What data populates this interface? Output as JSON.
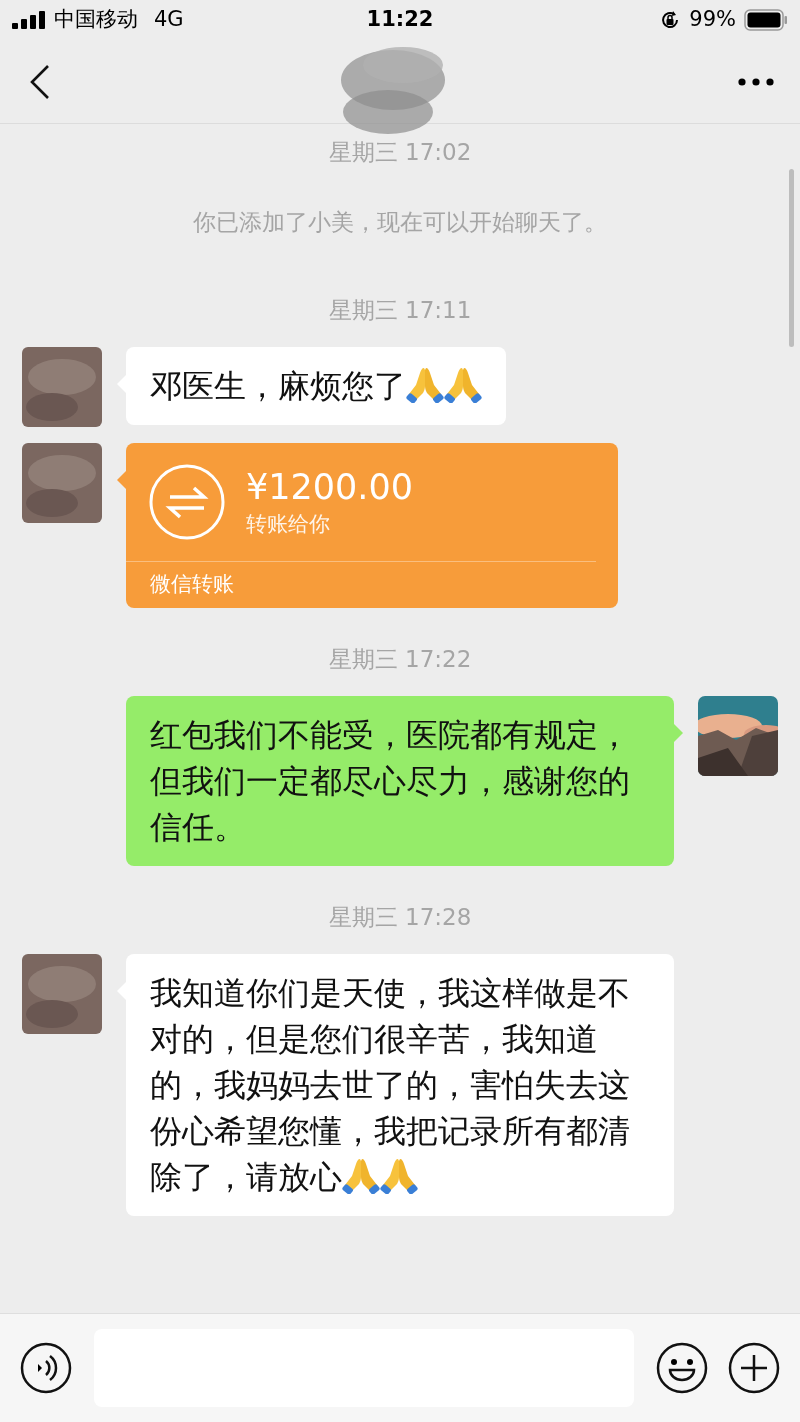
{
  "status_bar": {
    "carrier": "中国移动",
    "network": "4G",
    "time": "11:22",
    "battery": "99%"
  },
  "messages": [
    {
      "kind": "timestamp",
      "text": "星期三 17:02"
    },
    {
      "kind": "system",
      "text": "你已添加了小美，现在可以开始聊天了。"
    },
    {
      "kind": "timestamp",
      "text": "星期三 17:11"
    },
    {
      "kind": "text",
      "outgoing": false,
      "text": "邓医生，麻烦您了",
      "icons": [
        {
          "kind": "pray"
        },
        {
          "kind": "pray"
        }
      ]
    },
    {
      "kind": "transfer",
      "outgoing": false,
      "amount": "¥1200.00",
      "note": "转账给你",
      "footer": "微信转账"
    },
    {
      "kind": "timestamp",
      "text": "星期三 17:22"
    },
    {
      "kind": "text",
      "outgoing": true,
      "text": "红包我们不能受，医院都有规定，但我们一定都尽心尽力，感谢您的信任。"
    },
    {
      "kind": "timestamp",
      "text": "星期三 17:28"
    },
    {
      "kind": "text",
      "outgoing": false,
      "text": "我知道你们是天使，我这样做是不对的，但是您们很辛苦，我知道的，我妈妈去世了的，害怕失去这份心希望您懂，我把记录所有都清除了，请放心",
      "icons": [
        {
          "kind": "pray"
        },
        {
          "kind": "pray"
        }
      ]
    }
  ]
}
